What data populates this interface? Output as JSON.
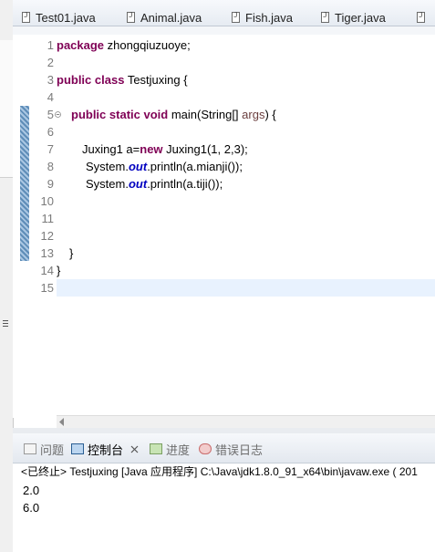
{
  "tabs": [
    {
      "label": "Test01.java"
    },
    {
      "label": "Animal.java"
    },
    {
      "label": "Fish.java"
    },
    {
      "label": "Tiger.java"
    }
  ],
  "editor": {
    "line_numbers": [
      "1",
      "2",
      "3",
      "4",
      "5",
      "6",
      "7",
      "8",
      "9",
      "10",
      "11",
      "12",
      "13",
      "14",
      "15"
    ],
    "line1": {
      "kw": "package",
      "rest": " zhongqiuzuoye;"
    },
    "line3": {
      "kw1": "public",
      "kw2": "class",
      "rest": " Testjuxing {"
    },
    "line5": {
      "kw1": "public",
      "kw2": "static",
      "kw3": "void",
      "mid": " main(String[] ",
      "param": "args",
      "end": ") {"
    },
    "line7": {
      "pre": "Juxing1 a=",
      "kw": "new",
      "rest": " Juxing1(1, 2,3);"
    },
    "line8": {
      "pre": "System.",
      "field": "out",
      "rest": ".println(a.mianji());"
    },
    "line9": {
      "pre": "System.",
      "field": "out",
      "rest": ".println(a.tiji());"
    },
    "line13": "}",
    "line14": "}"
  },
  "console_tabs": {
    "problems": "问题",
    "console": "控制台",
    "progress": "进度",
    "error_log": "错误日志"
  },
  "console": {
    "header": "<已终止> Testjuxing [Java 应用程序] C:\\Java\\jdk1.8.0_91_x64\\bin\\javaw.exe ( 201",
    "output": [
      "2.0",
      "6.0"
    ]
  }
}
